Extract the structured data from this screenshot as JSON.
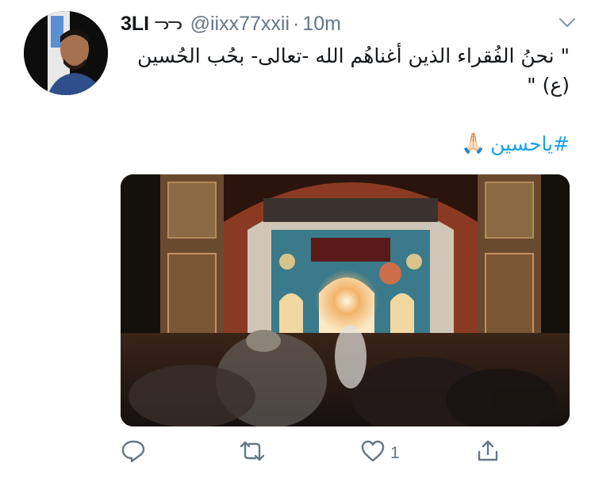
{
  "tweet": {
    "display_name": "3LI",
    "name_emoji": "ᓓᓓ",
    "handle": "@iixx77xxii",
    "separator": "·",
    "time": "10m",
    "text": "\" نحنُ الفُقراء الذين أغناهُم الله -تعالى- بحُب الحُسين (ع) \"",
    "hashtag": "#ياحسين",
    "hashtag_emoji": "🙏🏻",
    "like_count": "1"
  },
  "icons": {
    "menu": "chevron-down-icon",
    "reply": "reply-icon",
    "retweet": "retweet-icon",
    "like": "heart-icon",
    "share": "share-icon"
  },
  "colors": {
    "link": "#1da1f2",
    "muted": "#657786",
    "text": "#14171a"
  }
}
